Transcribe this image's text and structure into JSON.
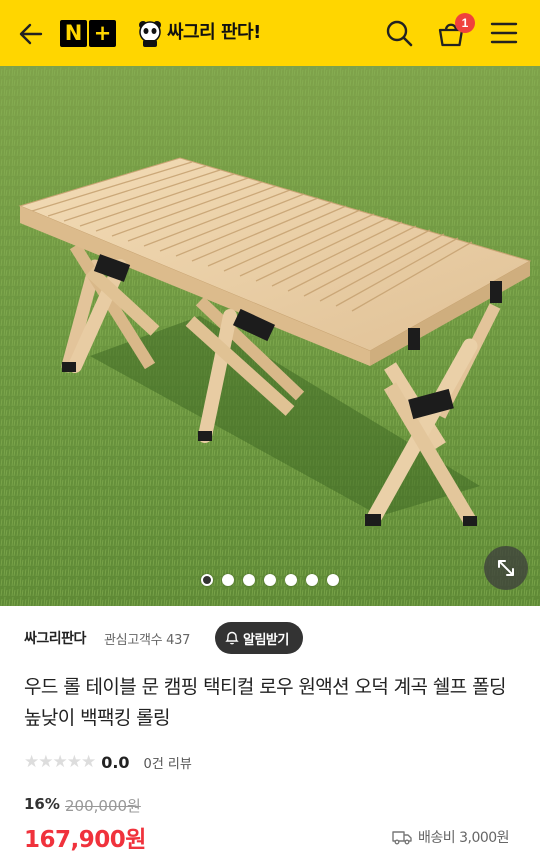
{
  "header": {
    "logo_text": "N+",
    "brand_name": "싸그리 판다!",
    "cart_count": "1",
    "icons": [
      "back-arrow-icon",
      "search-icon",
      "cart-icon",
      "menu-icon"
    ],
    "background": "#ffd600"
  },
  "hero": {
    "image_alt": "wooden roll table on grass",
    "slide_count": 7,
    "active_slide": 1
  },
  "seller": {
    "name": "싸그리판다",
    "followers": "관심고객수 437",
    "alarm_button": "알림받기"
  },
  "product": {
    "title": "우드 롤 테이블 문 캠핑 택티컬 로우 원액션 오덕 계곡 쉘프 폴딩 높낮이 백팩킹 롤링",
    "stars": "★★★★★",
    "rating": "0.0",
    "review_count": "0건 리뷰",
    "discount_rate": "16%",
    "original_price": "200,000원",
    "price": "167,900원",
    "shipping": "배송비 3,000원"
  },
  "colors": {
    "accent": "#ffd600",
    "price": "#f0323c",
    "badge": "#f0413c"
  }
}
